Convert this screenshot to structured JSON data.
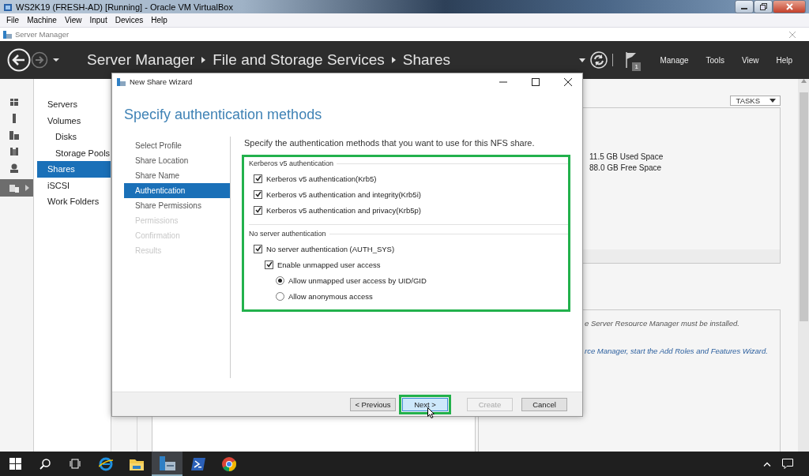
{
  "vm_window": {
    "title": "WS2K19 (FRESH-AD) [Running] - Oracle VM VirtualBox",
    "menu": [
      "File",
      "Machine",
      "View",
      "Input",
      "Devices",
      "Help"
    ]
  },
  "server_manager": {
    "title": "Server Manager",
    "breadcrumb": [
      "Server Manager",
      "File and Storage Services",
      "Shares"
    ],
    "notification_count": "1",
    "menu": [
      "Manage",
      "Tools",
      "View",
      "Help"
    ],
    "rail": [
      {
        "kind": "dashboard",
        "selected": false
      },
      {
        "kind": "server",
        "selected": false
      },
      {
        "kind": "servers",
        "selected": false
      },
      {
        "kind": "group",
        "selected": false
      },
      {
        "kind": "directory",
        "selected": false
      },
      {
        "kind": "files",
        "selected": true
      }
    ],
    "nav": [
      {
        "label": "Servers",
        "selected": false
      },
      {
        "label": "Volumes",
        "selected": false,
        "children": [
          {
            "label": "Disks",
            "selected": false
          },
          {
            "label": "Storage Pools",
            "selected": false
          }
        ]
      },
      {
        "label": "Shares",
        "selected": true
      },
      {
        "label": "iSCSI",
        "selected": false
      },
      {
        "label": "Work Folders",
        "selected": false
      }
    ],
    "tasks_button": "TASKS",
    "volume_panel": [
      "11.5 GB Used Space",
      "88.0 GB Free Space"
    ],
    "info_panel": [
      "e Server Resource Manager must be installed.",
      "rce Manager, start the Add Roles and Features Wizard."
    ]
  },
  "wizard": {
    "title": "New Share Wizard",
    "heading": "Specify authentication methods",
    "steps": [
      {
        "label": "Select Profile",
        "selected": false,
        "disabled": false
      },
      {
        "label": "Share Location",
        "selected": false,
        "disabled": false
      },
      {
        "label": "Share Name",
        "selected": false,
        "disabled": false
      },
      {
        "label": "Authentication",
        "selected": true,
        "disabled": false
      },
      {
        "label": "Share Permissions",
        "selected": false,
        "disabled": false
      },
      {
        "label": "Permissions",
        "selected": false,
        "disabled": true
      },
      {
        "label": "Confirmation",
        "selected": false,
        "disabled": true
      },
      {
        "label": "Results",
        "selected": false,
        "disabled": true
      }
    ],
    "description": "Specify the authentication methods that you want to use for this NFS share.",
    "options_highlighted": true,
    "groups": [
      {
        "title": "Kerberos v5 authentication",
        "items": [
          {
            "kind": "checkbox",
            "label": "Kerberos v5 authentication(Krb5)",
            "checked": true
          },
          {
            "kind": "checkbox",
            "label": "Kerberos v5 authentication and integrity(Krb5i)",
            "checked": true
          },
          {
            "kind": "checkbox",
            "label": "Kerberos v5 authentication and privacy(Krb5p)",
            "checked": true
          }
        ]
      },
      {
        "title": "No server authentication",
        "items": [
          {
            "kind": "checkbox",
            "label": "No server authentication (AUTH_SYS)",
            "checked": true,
            "children": [
              {
                "kind": "checkbox",
                "label": "Enable unmapped user access",
                "checked": true,
                "children": [
                  {
                    "kind": "radio",
                    "label": "Allow unmapped user access by UID/GID",
                    "selected": true
                  },
                  {
                    "kind": "radio",
                    "label": "Allow anonymous access",
                    "selected": false
                  }
                ]
              }
            ]
          }
        ]
      }
    ],
    "buttons": [
      {
        "label": "< Previous",
        "disabled": false,
        "focused": false,
        "highlighted": false
      },
      {
        "label": "Next >",
        "disabled": false,
        "focused": true,
        "highlighted": true
      },
      {
        "label": "Create",
        "disabled": true,
        "focused": false,
        "highlighted": false
      },
      {
        "label": "Cancel",
        "disabled": false,
        "focused": false,
        "highlighted": false
      }
    ]
  },
  "taskbar": {
    "apps": [
      {
        "kind": "edge",
        "selected": false
      },
      {
        "kind": "folder",
        "selected": false
      },
      {
        "kind": "server-manager",
        "selected": true
      },
      {
        "kind": "powershell",
        "selected": false
      },
      {
        "kind": "chrome",
        "selected": false
      }
    ]
  }
}
